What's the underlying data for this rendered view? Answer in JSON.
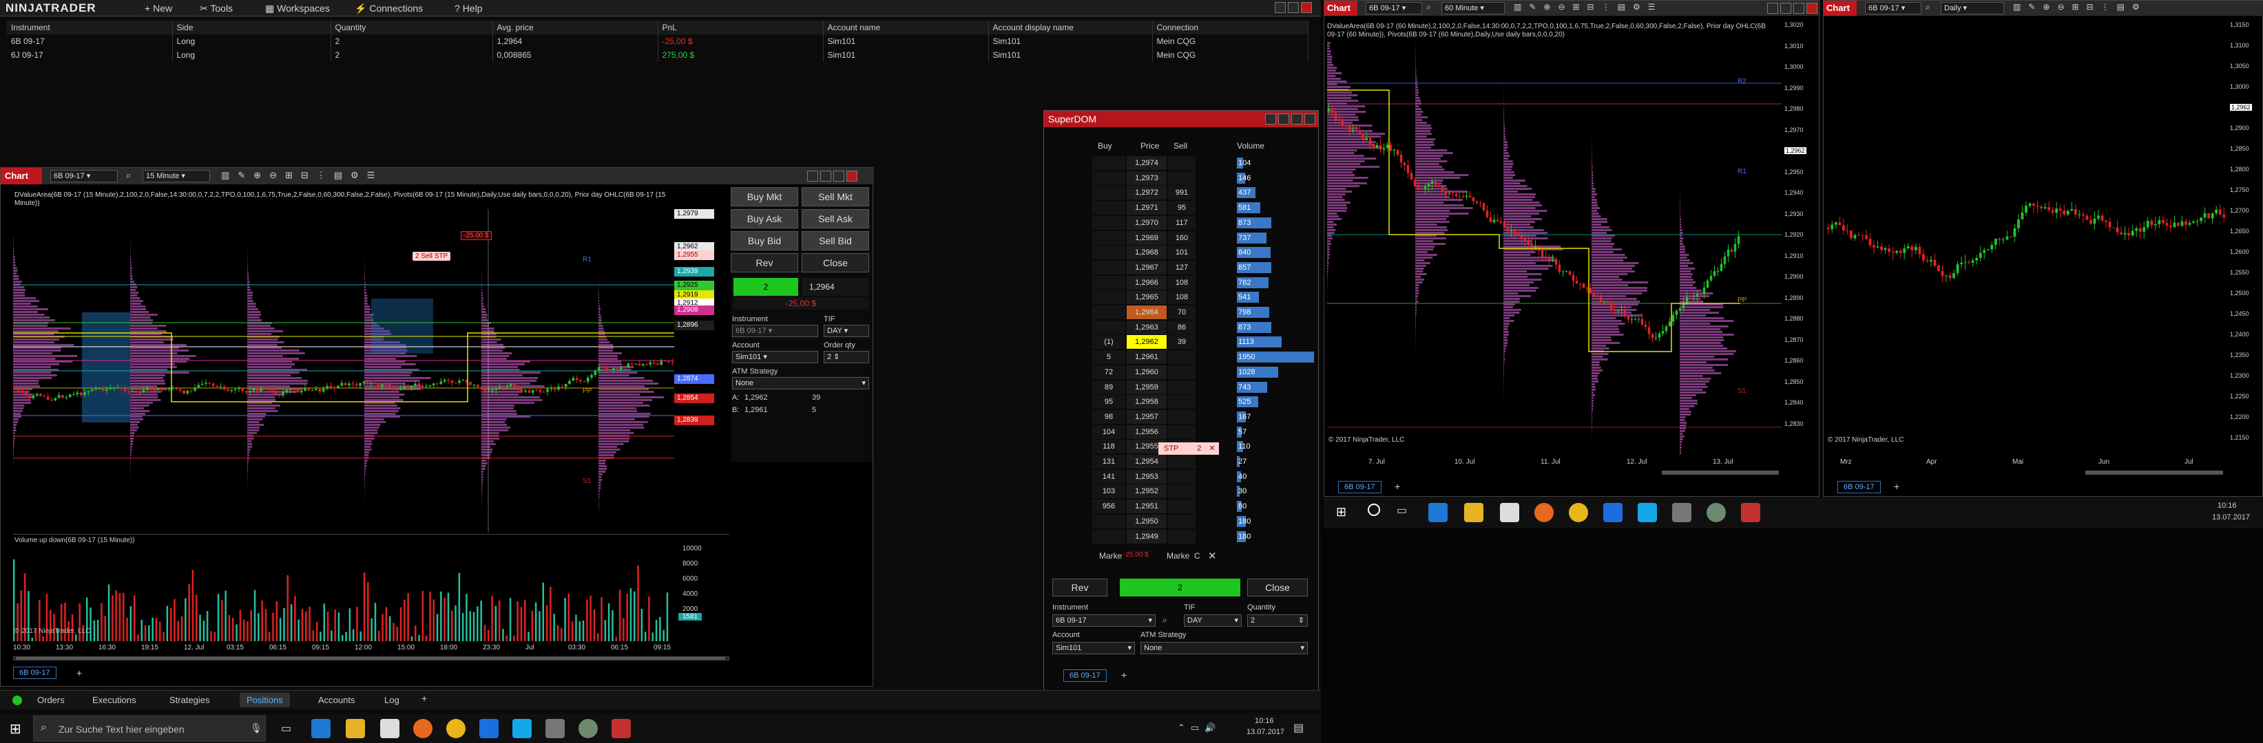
{
  "menu": {
    "logo": "NINJATRADER",
    "items": [
      "New",
      "Tools",
      "Workspaces",
      "Connections",
      "Help"
    ]
  },
  "positions": {
    "columns": [
      "Instrument",
      "Side",
      "Quantity",
      "Avg. price",
      "PnL",
      "Account name",
      "Account display name",
      "Connection"
    ],
    "rows": [
      {
        "instrument": "6B 09-17",
        "side": "Long",
        "quantity": "2",
        "avg_price": "1,2964",
        "pnl": "-25,00 $",
        "pnl_color": "#e23030",
        "account": "Sim101",
        "display": "Sim101",
        "connection": "Mein CQG"
      },
      {
        "instrument": "6J 09-17",
        "side": "Long",
        "quantity": "2",
        "avg_price": "0,008865",
        "pnl": "275,00 $",
        "pnl_color": "#2bd24a",
        "account": "Sim101",
        "display": "Sim101",
        "connection": "Mein CQG"
      }
    ]
  },
  "chart1": {
    "tab": "Chart",
    "instrument": "6B 09-17",
    "interval": "15 Minute",
    "indicator_text": "DValueArea(6B 09-17 (15 Minute),2,100,2,0,False,14:30:00,0,7,2,2,TPO,0,100,1,6,75,True,2,False,0,60,300,False,2,False), Pivots(6B 09-17 (15 Minute),Daily,Use daily bars,0,0,0,20), Prior day OHLC(6B 09-17 (15 Minute))",
    "price_labels": [
      "1,2979",
      "1,2962",
      "1,2955",
      "1,2939",
      "1,2925",
      "1,2919",
      "1,2912",
      "1,2908",
      "1,2896",
      "1,2874",
      "1,2854",
      "1,2839"
    ],
    "order_tag": "2  Sell STP",
    "pnl_tag": "-25,00 $",
    "pivot_labels": [
      "R1",
      "PP",
      "S1"
    ],
    "volume_title": "Volume up down(6B 09-17 (15 Minute))",
    "volume_ticks": [
      "10000",
      "8000",
      "6000",
      "4000",
      "2000"
    ],
    "volume_value": "1581",
    "copyright": "© 2017 NinjaTrader, LLC",
    "x_ticks": [
      "10:30",
      "13:30",
      "16:30",
      "19:15",
      "12. Jul",
      "03:15",
      "06:15",
      "09:15",
      "12:00",
      "15:00",
      "18:00",
      "23:30",
      "Jul",
      "03:30",
      "06:15",
      "09:15"
    ],
    "bottom_tab": "6B 09-17"
  },
  "chart_trader": {
    "buttons": [
      "Buy Mkt",
      "Sell Mkt",
      "Buy Ask",
      "Sell Ask",
      "Buy Bid",
      "Sell Bid",
      "Rev",
      "Close"
    ],
    "position_qty": "2",
    "position_price": "1,2964",
    "position_pnl": "-25,00 $",
    "instrument_label": "Instrument",
    "instrument": "6B 09-17",
    "tif_label": "TIF",
    "tif": "DAY",
    "account_label": "Account",
    "account": "Sim101",
    "qty_label": "Order qty",
    "qty": "2",
    "atm_label": "ATM Strategy",
    "atm": "None",
    "ask": {
      "label": "A:",
      "price": "1,2962",
      "size": "39"
    },
    "bid": {
      "label": "B:",
      "price": "1,2961",
      "size": "5"
    }
  },
  "superdom": {
    "title": "SuperDOM",
    "headers": {
      "buy": "Buy",
      "price": "Price",
      "sell": "Sell",
      "volume": "Volume"
    },
    "rows": [
      {
        "buy": "",
        "price": "1,2974",
        "sell": "",
        "vol": "104",
        "vol_frac": 0.08
      },
      {
        "buy": "",
        "price": "1,2973",
        "sell": "",
        "vol": "146",
        "vol_frac": 0.11
      },
      {
        "buy": "",
        "price": "1,2972",
        "sell": "991",
        "vol": "437",
        "vol_frac": 0.24
      },
      {
        "buy": "",
        "price": "1,2971",
        "sell": "95",
        "vol": "581",
        "vol_frac": 0.3
      },
      {
        "buy": "",
        "price": "1,2970",
        "sell": "117",
        "vol": "873",
        "vol_frac": 0.45
      },
      {
        "buy": "",
        "price": "1,2969",
        "sell": "160",
        "vol": "737",
        "vol_frac": 0.38
      },
      {
        "buy": "",
        "price": "1,2968",
        "sell": "101",
        "vol": "840",
        "vol_frac": 0.44
      },
      {
        "buy": "",
        "price": "1,2967",
        "sell": "127",
        "vol": "857",
        "vol_frac": 0.45
      },
      {
        "buy": "",
        "price": "1,2966",
        "sell": "108",
        "vol": "782",
        "vol_frac": 0.41
      },
      {
        "buy": "",
        "price": "1,2965",
        "sell": "108",
        "vol": "541",
        "vol_frac": 0.29
      },
      {
        "buy": "",
        "price": "1,2964",
        "sell": "70",
        "vol": "798",
        "vol_frac": 0.42
      },
      {
        "buy": "",
        "price": "1,2963",
        "sell": "86",
        "vol": "873",
        "vol_frac": 0.45
      },
      {
        "buy": "(1)",
        "price": "1,2962",
        "sell": "39",
        "vol": "1113",
        "vol_frac": 0.58
      },
      {
        "buy": "5",
        "price": "1,2961",
        "sell": "",
        "vol": "1950",
        "vol_frac": 1.0
      },
      {
        "buy": "72",
        "price": "1,2960",
        "sell": "",
        "vol": "1028",
        "vol_frac": 0.54
      },
      {
        "buy": "89",
        "price": "1,2959",
        "sell": "",
        "vol": "743",
        "vol_frac": 0.39
      },
      {
        "buy": "95",
        "price": "1,2958",
        "sell": "",
        "vol": "525",
        "vol_frac": 0.28
      },
      {
        "buy": "98",
        "price": "1,2957",
        "sell": "",
        "vol": "167",
        "vol_frac": 0.12
      },
      {
        "buy": "104",
        "price": "1,2956",
        "sell": "",
        "vol": "57",
        "vol_frac": 0.06
      },
      {
        "buy": "118",
        "price": "1,2955",
        "sell": "",
        "vol": "110",
        "vol_frac": 0.08
      },
      {
        "buy": "131",
        "price": "1,2954",
        "sell": "",
        "vol": "27",
        "vol_frac": 0.04
      },
      {
        "buy": "141",
        "price": "1,2953",
        "sell": "",
        "vol": "40",
        "vol_frac": 0.05
      },
      {
        "buy": "103",
        "price": "1,2952",
        "sell": "",
        "vol": "30",
        "vol_frac": 0.04
      },
      {
        "buy": "956",
        "price": "1,2951",
        "sell": "",
        "vol": "80",
        "vol_frac": 0.06
      },
      {
        "buy": "",
        "price": "1,2950",
        "sell": "",
        "vol": "180",
        "vol_frac": 0.12
      },
      {
        "buy": "",
        "price": "1,2949",
        "sell": "",
        "vol": "180",
        "vol_frac": 0.12
      }
    ],
    "stp_tag": "STP",
    "stp_qty": "2",
    "bottom": {
      "market_left": "Marke",
      "pnl": "-25,00 $",
      "market_right": "Marke",
      "c": "C"
    },
    "rev": "Rev",
    "qty_box": "2",
    "close": "Close",
    "instrument_label": "Instrument",
    "instrument": "6B 09-17",
    "tif_label": "TIF",
    "tif": "DAY",
    "qty_label": "Quantity",
    "qty": "2",
    "account_label": "Account",
    "account": "Sim101",
    "atm_label": "ATM Strategy",
    "atm": "None",
    "bottom_tab": "6B 09-17"
  },
  "chart2": {
    "tab": "Chart",
    "instrument": "6B 09-17",
    "interval": "60 Minute",
    "indicator_text": "DValueArea(6B 09-17 (60 Minute),2,100,2,0,False,14:30:00,0,7,2,2,TPO,0,100,1,6,75,True,2,False,0,60,300,False,2,False), Prior day OHLC(6B 09-17 (60 Minute)), Pivots(6B 09-17 (60 Minute),Daily,Use daily bars,0,0,0,20)",
    "y_ticks": [
      "1,3020",
      "1,3010",
      "1,3000",
      "1,2990",
      "1,2980",
      "1,2970",
      "1,2962",
      "1,2950",
      "1,2940",
      "1,2930",
      "1,2920",
      "1,2910",
      "1,2900",
      "1,2890",
      "1,2880",
      "1,2870",
      "1,2860",
      "1,2850",
      "1,2840",
      "1,2830"
    ],
    "x_ticks": [
      "7. Jul",
      "10. Jul",
      "11. Jul",
      "12. Jul",
      "13. Jul"
    ],
    "pivot_labels": [
      "R2",
      "R1",
      "PP",
      "S1"
    ],
    "copyright": "© 2017 NinjaTrader, LLC",
    "bottom_tab": "6B 09-17"
  },
  "chart3": {
    "tab": "Chart",
    "instrument": "6B 09-17",
    "interval": "Daily",
    "y_ticks": [
      "1,3150",
      "1,3100",
      "1,3050",
      "1,3000",
      "1,2962",
      "1,2900",
      "1,2850",
      "1,2800",
      "1,2750",
      "1,2700",
      "1,2650",
      "1,2600",
      "1,2550",
      "1,2500",
      "1,2450",
      "1,2400",
      "1,2350",
      "1,2300",
      "1,2250",
      "1,2200",
      "1,2150"
    ],
    "x_ticks": [
      "Mrz",
      "Apr",
      "Mai",
      "Jun",
      "Jul"
    ],
    "copyright": "© 2017 NinjaTrader, LLC",
    "bottom_tab": "6B 09-17"
  },
  "bottom_tabs": [
    "Orders",
    "Executions",
    "Strategies",
    "Positions",
    "Accounts",
    "Log"
  ],
  "active_bottom_tab": "Positions",
  "taskbar": {
    "search_placeholder": "Zur Suche Text hier eingeben",
    "time": "10:16",
    "date": "13.07.2017"
  },
  "taskbar2": {
    "time": "10:16",
    "date": "13.07.2017"
  }
}
